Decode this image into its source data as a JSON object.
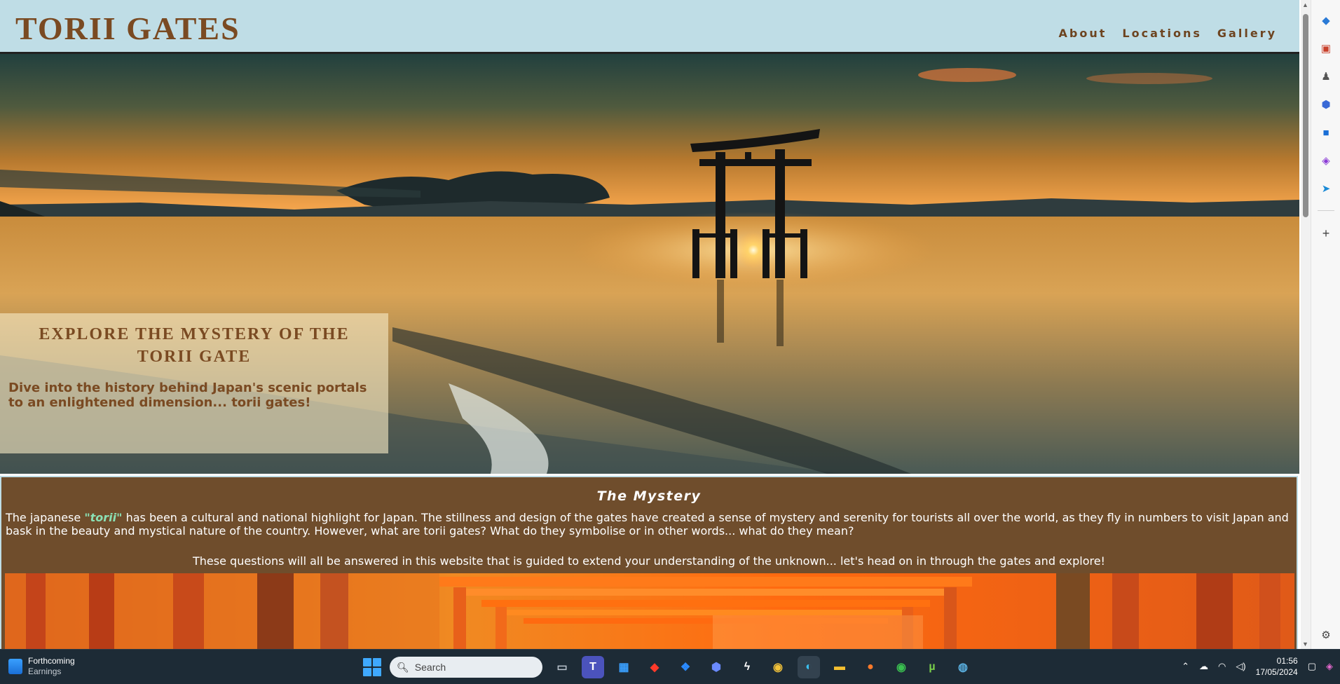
{
  "site": {
    "title": "TORII GATES",
    "nav": [
      "About",
      "Locations",
      "Gallery"
    ]
  },
  "hero": {
    "heading": "EXPLORE THE MYSTERY OF THE TORII GATE",
    "text": "Dive into the history behind Japan's scenic portals to an enlightened dimension... torii gates!"
  },
  "mystery": {
    "title": "The Mystery",
    "p1_before": "The japanese ",
    "p1_highlight": "\"torii\"",
    "p1_after": " has been a cultural and national highlight for Japan. The stillness and design of the gates have created a sense of mystery and serenity for tourists all over the world, as they fly in numbers to visit Japan and bask in the beauty and mystical nature of the country. However, what are torii gates? What do they symbolise or in other words... what do they mean?",
    "p2": "These questions will all be answered in this website that is guided to extend your understanding of the unknown... let's head on in through the gates and explore!"
  },
  "sidebar": {
    "icons": [
      "tag-icon",
      "briefcase-icon",
      "games-icon",
      "copilot-icon",
      "outlook-icon",
      "drop-icon",
      "send-icon",
      "add-icon",
      "settings-icon"
    ]
  },
  "taskbar": {
    "widget_title": "Forthcoming",
    "widget_subtitle": "Earnings",
    "search_placeholder": "Search",
    "apps": [
      "task-view",
      "teams",
      "store",
      "diamond-app",
      "dropbox",
      "copilot-app",
      "lightning-app",
      "chrome",
      "edge",
      "file-explorer",
      "firefox",
      "chrome-profile",
      "utorrent",
      "globe-app"
    ],
    "time": "01:56",
    "date": "17/05/2024"
  },
  "colors": {
    "header_bg": "#bfdde6",
    "brand_brown": "#7a4a22",
    "section_bg": "#6f4d2c",
    "highlight": "#8be0b4"
  }
}
